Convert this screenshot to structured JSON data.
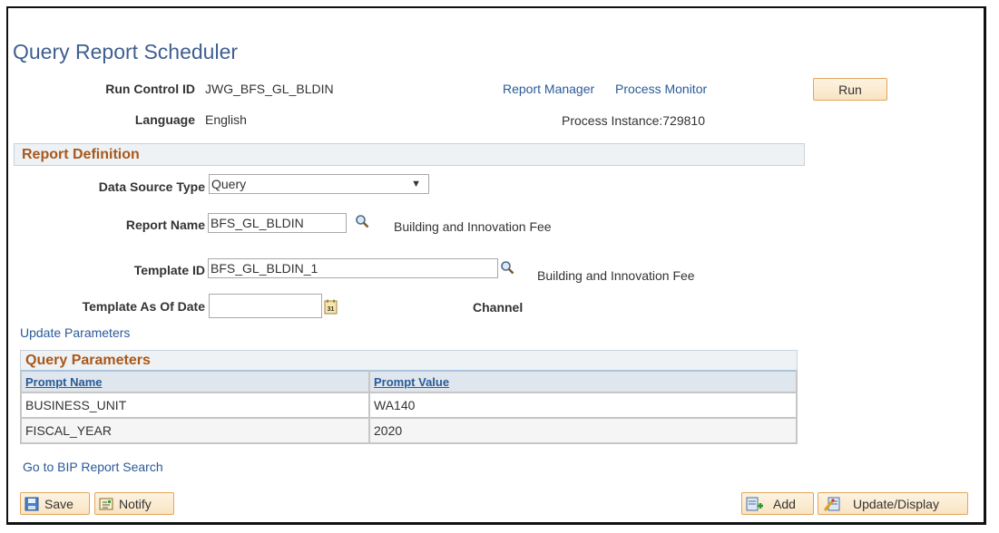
{
  "page": {
    "title": "Query Report Scheduler"
  },
  "header": {
    "run_control_label": "Run Control ID",
    "run_control_value": "JWG_BFS_GL_BLDIN",
    "language_label": "Language",
    "language_value": "English",
    "report_manager_link": "Report Manager",
    "process_monitor_link": "Process Monitor",
    "run_button": "Run",
    "process_instance": "Process Instance:729810"
  },
  "report_definition": {
    "section_title": "Report Definition",
    "data_source_type_label": "Data Source Type",
    "data_source_type_value": "Query",
    "report_name_label": "Report Name",
    "report_name_value": "BFS_GL_BLDIN",
    "report_name_description": "Building and Innovation Fee",
    "template_id_label": "Template ID",
    "template_id_value": "BFS_GL_BLDIN_1",
    "template_id_description": "Building and Innovation Fee",
    "template_as_of_date_label": "Template As Of Date",
    "template_as_of_date_value": "",
    "channel_label": "Channel",
    "update_parameters_link": "Update Parameters"
  },
  "query_parameters": {
    "section_title": "Query Parameters",
    "columns": [
      "Prompt Name",
      "Prompt Value"
    ],
    "rows": [
      {
        "prompt_name": "BUSINESS_UNIT",
        "prompt_value": "WA140"
      },
      {
        "prompt_name": "FISCAL_YEAR",
        "prompt_value": "2020"
      }
    ]
  },
  "footer": {
    "bip_search_link": "Go to BIP Report Search",
    "save_button": "Save",
    "notify_button": "Notify",
    "add_button": "Add",
    "update_display_button": "Update/Display"
  },
  "colors": {
    "title": "#3f5f8f",
    "link": "#2a5a9a",
    "section_title": "#a8581b",
    "button_border": "#e2a65a",
    "button_bg": "#fdf3e1"
  },
  "icons": {
    "lookup": "magnifier-icon",
    "calendar": "calendar-icon",
    "save": "floppy-disk-icon",
    "notify": "notify-icon",
    "add": "add-document-icon",
    "update_display": "pencil-document-icon"
  }
}
